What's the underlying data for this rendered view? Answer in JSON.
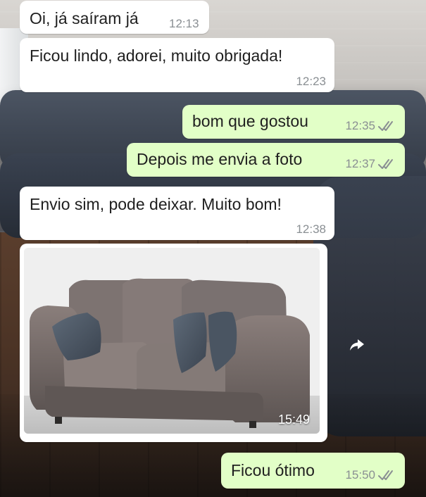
{
  "chat": {
    "messages": [
      {
        "id": "m1",
        "direction": "incoming",
        "text": "Oi, já saíram já",
        "time": "12:13"
      },
      {
        "id": "m2",
        "direction": "incoming",
        "text": "Ficou lindo, adorei, muito obrigada!",
        "time": "12:23"
      },
      {
        "id": "m3",
        "direction": "outgoing",
        "text": "bom que gostou",
        "time": "12:35",
        "status": "read"
      },
      {
        "id": "m4",
        "direction": "outgoing",
        "text": "Depois me envia a foto",
        "time": "12:37",
        "status": "read"
      },
      {
        "id": "m5",
        "direction": "incoming",
        "text": "Envio sim, pode deixar. Muito bom!",
        "time": "12:38"
      },
      {
        "id": "m6",
        "direction": "incoming",
        "type": "image",
        "image_subject": "sofa-photo",
        "time": "15:49"
      },
      {
        "id": "m7",
        "direction": "outgoing",
        "text": "Ficou ótimo",
        "time": "15:50",
        "status": "read"
      }
    ]
  },
  "icons": {
    "read_ticks": "double-check-icon",
    "forward": "forward-icon"
  },
  "colors": {
    "incoming_bubble": "#ffffff",
    "outgoing_bubble": "#e2ffc7",
    "meta_text": "#8a8f93",
    "ticks": "#8a8f93"
  }
}
